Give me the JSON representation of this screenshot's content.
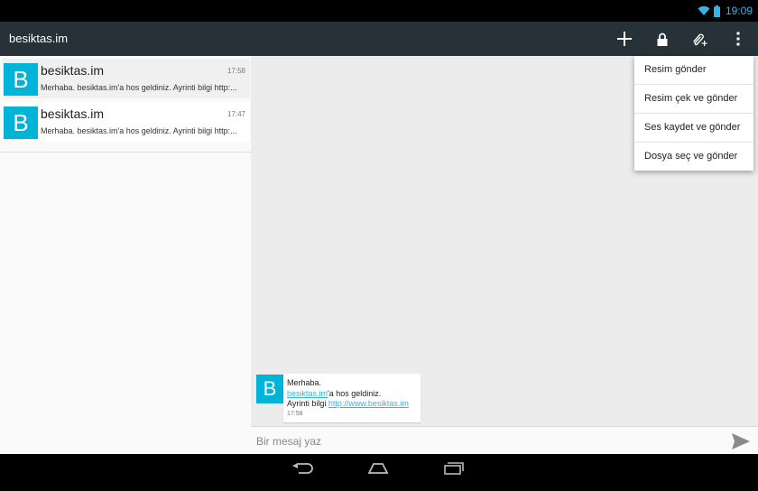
{
  "status_bar": {
    "time": "19:09",
    "icons": [
      "wifi-icon",
      "battery-icon"
    ],
    "accent": "#33b5e5"
  },
  "action_bar": {
    "title": "besiktas.im",
    "actions": [
      "add-icon",
      "lock-icon",
      "attach-icon",
      "overflow-menu-icon"
    ],
    "background": "#263238"
  },
  "conversations": [
    {
      "avatar": "B",
      "name": "besiktas.im",
      "time": "17:58",
      "preview": "Merhaba. besiktas.im'a hos geldiniz. Ayrinti bilgi http:..."
    },
    {
      "avatar": "B",
      "name": "besiktas.im",
      "time": "17:47",
      "preview": "Merhaba. besiktas.im'a hos geldiniz. Ayrinti bilgi http:..."
    }
  ],
  "message": {
    "avatar": "B",
    "line1": "Merhaba.",
    "link1": "besiktas.im",
    "line2_rest": "'a hos geldiniz.",
    "line3_prefix": "Ayrinti bilgi ",
    "link2": "http://www.besiktas.im",
    "time": "17:58"
  },
  "composer": {
    "placeholder": "Bir mesaj yaz"
  },
  "attach_menu": {
    "items": [
      "Resim gönder",
      "Resim çek ve gönder",
      "Ses kaydet ve gönder",
      "Dosya seç ve gönder"
    ]
  },
  "colors": {
    "avatar": "#00b4d8",
    "link": "#33b5e5"
  }
}
